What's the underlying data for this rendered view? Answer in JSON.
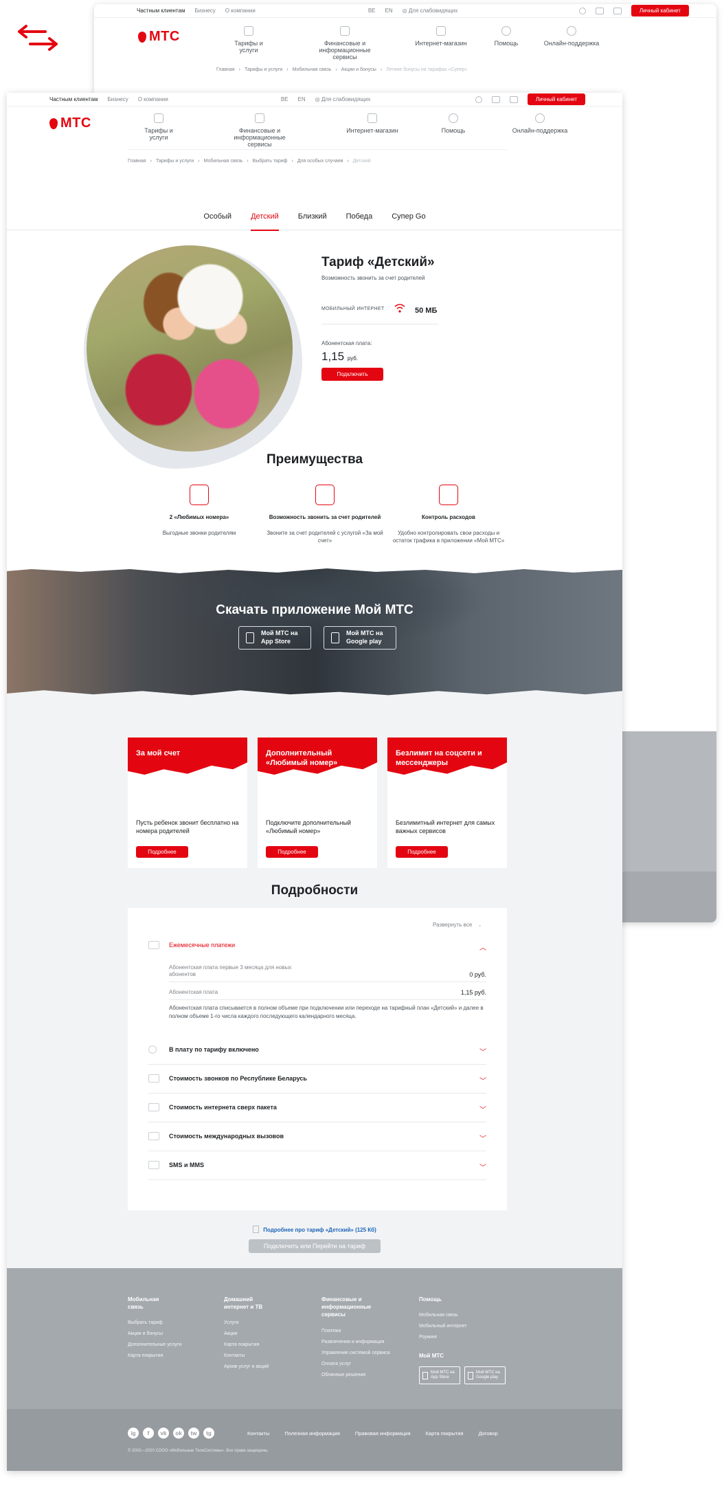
{
  "back_page": {
    "topbar": {
      "segments": [
        "Частным клиентам",
        "Бизнесу",
        "О компании"
      ],
      "langs": [
        "BE",
        "EN"
      ],
      "accessibility": "Для слабовидящих",
      "cabinet_button": "Личный кабинет"
    },
    "logo_text": "МТС",
    "nav": [
      "Тарифы и услуги",
      "Финансовые и информационные сервисы",
      "Интернет-магазин",
      "Помощь",
      "Онлайн-поддержка"
    ],
    "breadcrumbs": [
      "Главная",
      "Тарифы и услуги",
      "Мобильная связь",
      "Акции и бонусы",
      "Летние бонусы на тарифах «Супер»"
    ]
  },
  "front_page": {
    "topbar": {
      "segments": [
        "Частным клиентам",
        "Бизнесу",
        "О компании"
      ],
      "langs": [
        "BE",
        "EN"
      ],
      "accessibility": "Для слабовидящих",
      "cabinet_button": "Личный кабинет"
    },
    "logo_text": "МТС",
    "nav": [
      "Тарифы и услуги",
      "Финансовые и информационные сервисы",
      "Интернет-магазин",
      "Помощь",
      "Онлайн-поддержка"
    ],
    "breadcrumbs": [
      "Главная",
      "Тарифы и услуги",
      "Мобильная связь",
      "Выбрать тариф",
      "Для особых случаев",
      "Детский"
    ],
    "tabs": [
      {
        "label": "Особый",
        "active": false
      },
      {
        "label": "Детский",
        "active": true
      },
      {
        "label": "Близкий",
        "active": false
      },
      {
        "label": "Победа",
        "active": false
      },
      {
        "label": "Супер Go",
        "active": false
      }
    ],
    "hero": {
      "title": "Тариф «Детский»",
      "subtitle": "Возможность звонить за счет родителей",
      "internet_label": "Мобильный интернет",
      "internet_value": "50 МБ",
      "fee_label": "Абонентская плата:",
      "fee_value": "1,15",
      "fee_unit": "руб.",
      "connect_button": "Подключить"
    },
    "advantages": {
      "title": "Преимущества",
      "items": [
        {
          "title": "2 «Любимых номера»",
          "desc": "Выгодные звонки родителям",
          "icon": "phone-heart-icon"
        },
        {
          "title": "Возможность звонить за счет родителей",
          "desc": "Звоните за счет родителей с услугой «За мой счет»",
          "icon": "hand-phone-icon"
        },
        {
          "title": "Контроль расходов",
          "desc": "Удобно контролировать свои расходы и остаток трафика в приложении «Мой МТС»",
          "icon": "chart-board-icon"
        }
      ]
    },
    "app_banner": {
      "title": "Скачать приложение Мой МТС",
      "store1": "Мой МТС на App Store",
      "store2": "Мой МТС на Google play"
    },
    "cards": [
      {
        "title": "За мой счет",
        "desc": "Пусть ребенок звонит бесплатно на номера родителей",
        "button": "Подробнее"
      },
      {
        "title": "Дополнительный «Любимый номер»",
        "desc": "Подключите дополнительный «Любимый номер»",
        "button": "Подробнее"
      },
      {
        "title": "Безлимит на соцсети и мессенджеры",
        "desc": "Безлимитный интернет для самых важных сервисов",
        "button": "Подробнее"
      }
    ],
    "details": {
      "title": "Подробности",
      "expand_all": "Развернуть все",
      "open_section": "Ежемесячные платежи",
      "payments": [
        {
          "label": "Абонентская плата первые 3 месяца для новых абонентов",
          "value": "0 руб."
        },
        {
          "label": "Абонентская плата",
          "value": "1,15 руб."
        }
      ],
      "note": "Абонентская плата списывается в полном объеме при подключении или переходе на тарифный план «Детский» и далее в полном объеме 1-го числа каждого последующего календарного месяца.",
      "sections": [
        "В плату по тарифу включено",
        "Стоимость звонков по Республике Беларусь",
        "Стоимость интернета сверх пакета",
        "Стоимость международных вызовов",
        "SMS и MMS"
      ]
    },
    "more_link": "Подробнее про тариф «Детский» (125 Кб)",
    "connect_switch": "Подключить или Перейти на тариф",
    "footer": {
      "columns": [
        {
          "heading": "Мобильная связь",
          "links": [
            "Выбрать тариф",
            "Акции и бонусы",
            "Дополнительные услуги",
            "Карта покрытия"
          ]
        },
        {
          "heading": "Домашний интернет и ТВ",
          "links": [
            "Услуги",
            "Акции",
            "Карта покрытия",
            "Контакты",
            "Архив услуг и акций"
          ]
        },
        {
          "heading": "Финансовые и информационные сервисы",
          "links": [
            "Платежи",
            "Развлечения и информация",
            "Управление системой сервиса",
            "Оплата услуг",
            "Облачные решения"
          ]
        },
        {
          "heading": "Помощь",
          "links": [
            "Мобильная связь",
            "Мобильный интернет",
            "Роуминг"
          ]
        }
      ],
      "app_heading": "Мой МТС",
      "stores": [
        "Мой МТС на App Store",
        "Мой МТС на Google play"
      ],
      "socials": [
        "ig",
        "f",
        "vk",
        "ok",
        "tw",
        "tg"
      ],
      "bottom_links": [
        "Контакты",
        "Полезная информация",
        "Правовая информация",
        "Карта покрытия",
        "Договор"
      ],
      "copyright": "© 2002—2020 СООО «Мобильные ТелеСистемы». Все права защищены."
    }
  }
}
